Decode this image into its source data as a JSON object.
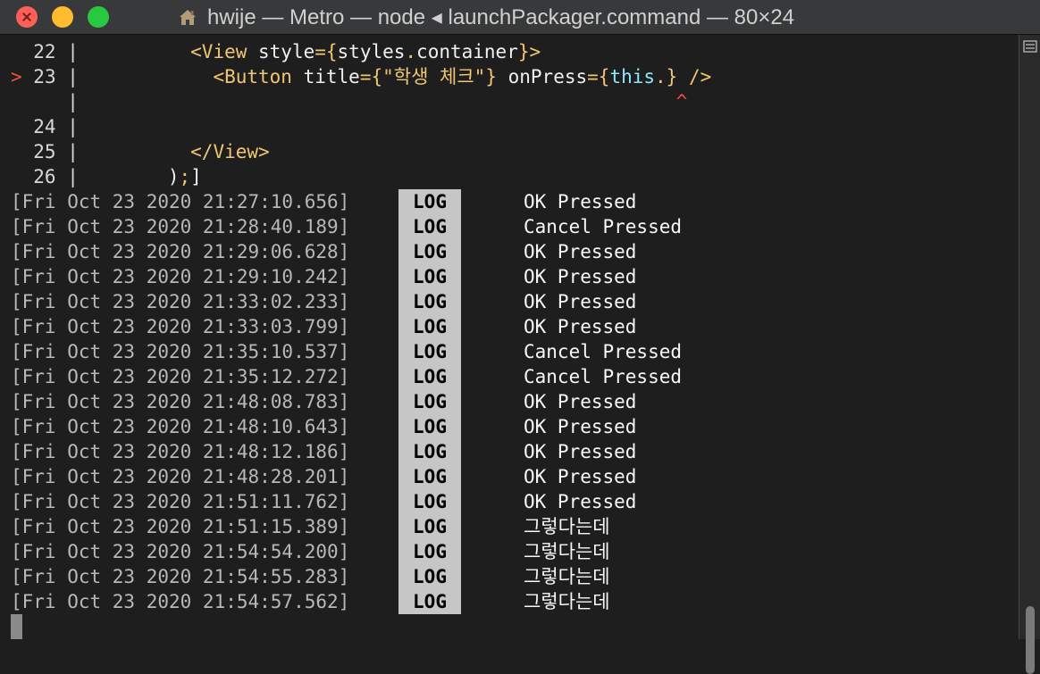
{
  "window": {
    "title": "hwije — Metro — node ◂ launchPackager.command — 80×24",
    "icon": "home-folder-icon",
    "colors": {
      "close": "#fe5f57",
      "minimize": "#febc2e",
      "maximize": "#28c840"
    }
  },
  "code_frame": {
    "lines": [
      {
        "marker": "",
        "gutter": " 22 |",
        "parts": [
          {
            "cls": "plain",
            "text": "        "
          },
          {
            "cls": "tag",
            "text": "<View "
          },
          {
            "cls": "plain",
            "text": "style"
          },
          {
            "cls": "op",
            "text": "={"
          },
          {
            "cls": "plain",
            "text": "styles"
          },
          {
            "cls": "op",
            "text": "."
          },
          {
            "cls": "plain",
            "text": "container"
          },
          {
            "cls": "op",
            "text": "}"
          },
          {
            "cls": "tag",
            "text": ">"
          }
        ]
      },
      {
        "marker": ">",
        "gutter": " 23 |",
        "parts": [
          {
            "cls": "plain",
            "text": "          "
          },
          {
            "cls": "tag",
            "text": "<Button "
          },
          {
            "cls": "plain",
            "text": "title"
          },
          {
            "cls": "op",
            "text": "={"
          },
          {
            "cls": "str",
            "text": "\"학생 체크\""
          },
          {
            "cls": "op",
            "text": "} "
          },
          {
            "cls": "plain",
            "text": "onPress"
          },
          {
            "cls": "op",
            "text": "={"
          },
          {
            "cls": "kw",
            "text": "this"
          },
          {
            "cls": "op",
            "text": ".} "
          },
          {
            "cls": "tag",
            "text": "/>"
          }
        ]
      },
      {
        "marker": "",
        "gutter": "    |",
        "parts": [
          {
            "cls": "caret",
            "text": "                                                   ^"
          }
        ]
      },
      {
        "marker": "",
        "gutter": " 24 |",
        "parts": []
      },
      {
        "marker": "",
        "gutter": " 25 |",
        "parts": [
          {
            "cls": "plain",
            "text": "        "
          },
          {
            "cls": "tag",
            "text": "</View>"
          }
        ]
      },
      {
        "marker": "",
        "gutter": " 26 |",
        "parts": [
          {
            "cls": "plain",
            "text": "      )"
          },
          {
            "cls": "op",
            "text": ";"
          },
          {
            "cls": "plain",
            "text": "]"
          }
        ]
      }
    ]
  },
  "logs": [
    {
      "timestamp": "[Fri Oct 23 2020 21:27:10.656]",
      "level": "LOG",
      "message": "OK Pressed"
    },
    {
      "timestamp": "[Fri Oct 23 2020 21:28:40.189]",
      "level": "LOG",
      "message": "Cancel Pressed"
    },
    {
      "timestamp": "[Fri Oct 23 2020 21:29:06.628]",
      "level": "LOG",
      "message": "OK Pressed"
    },
    {
      "timestamp": "[Fri Oct 23 2020 21:29:10.242]",
      "level": "LOG",
      "message": "OK Pressed"
    },
    {
      "timestamp": "[Fri Oct 23 2020 21:33:02.233]",
      "level": "LOG",
      "message": "OK Pressed"
    },
    {
      "timestamp": "[Fri Oct 23 2020 21:33:03.799]",
      "level": "LOG",
      "message": "OK Pressed"
    },
    {
      "timestamp": "[Fri Oct 23 2020 21:35:10.537]",
      "level": "LOG",
      "message": "Cancel Pressed"
    },
    {
      "timestamp": "[Fri Oct 23 2020 21:35:12.272]",
      "level": "LOG",
      "message": "Cancel Pressed"
    },
    {
      "timestamp": "[Fri Oct 23 2020 21:48:08.783]",
      "level": "LOG",
      "message": "OK Pressed"
    },
    {
      "timestamp": "[Fri Oct 23 2020 21:48:10.643]",
      "level": "LOG",
      "message": "OK Pressed"
    },
    {
      "timestamp": "[Fri Oct 23 2020 21:48:12.186]",
      "level": "LOG",
      "message": "OK Pressed"
    },
    {
      "timestamp": "[Fri Oct 23 2020 21:48:28.201]",
      "level": "LOG",
      "message": "OK Pressed"
    },
    {
      "timestamp": "[Fri Oct 23 2020 21:51:11.762]",
      "level": "LOG",
      "message": "OK Pressed"
    },
    {
      "timestamp": "[Fri Oct 23 2020 21:51:15.389]",
      "level": "LOG",
      "message": "그렇다는데"
    },
    {
      "timestamp": "[Fri Oct 23 2020 21:54:54.200]",
      "level": "LOG",
      "message": "그렇다는데"
    },
    {
      "timestamp": "[Fri Oct 23 2020 21:54:55.283]",
      "level": "LOG",
      "message": "그렇다는데"
    },
    {
      "timestamp": "[Fri Oct 23 2020 21:54:57.562]",
      "level": "LOG",
      "message": "그렇다는데"
    }
  ]
}
